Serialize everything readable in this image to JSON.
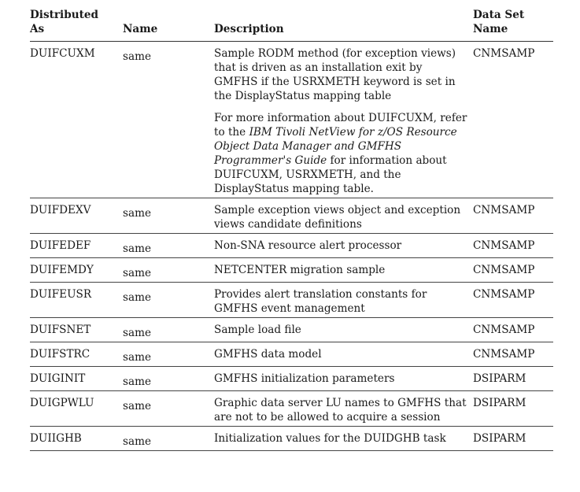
{
  "header": {
    "distributed_as": "Distributed\nAs",
    "name": "Name",
    "description": "Description",
    "data_set_name": "Data Set\nName"
  },
  "rows": [
    {
      "distributed_as": "DUIFCUXM",
      "name": "same",
      "description_p1": "Sample RODM method (for exception views) that is driven as an installation exit by GMFHS if the USRXMETH keyword is set in the DisplayStatus mapping table",
      "description_p2_pre": "For more information about DUIFCUXM, refer to the ",
      "description_p2_em": "IBM Tivoli NetView for z/OS Resource Object Data Manager and GMFHS Programmer's Guide",
      "description_p2_post": " for information about DUIFCUXM, USRXMETH, and the DisplayStatus mapping table.",
      "data_set": "CNMSAMP"
    },
    {
      "distributed_as": "DUIFDEXV",
      "name": "same",
      "description": "Sample exception views object and exception views candidate definitions",
      "data_set": "CNMSAMP"
    },
    {
      "distributed_as": "DUIFEDEF",
      "name": "same",
      "description": "Non-SNA resource alert processor",
      "data_set": "CNMSAMP"
    },
    {
      "distributed_as": "DUIFEMDY",
      "name": "same",
      "description": "NETCENTER migration sample",
      "data_set": "CNMSAMP"
    },
    {
      "distributed_as": "DUIFEUSR",
      "name": "same",
      "description": "Provides alert translation constants for GMFHS event management",
      "data_set": "CNMSAMP"
    },
    {
      "distributed_as": "DUIFSNET",
      "name": "same",
      "description": "Sample load file",
      "data_set": "CNMSAMP"
    },
    {
      "distributed_as": "DUIFSTRC",
      "name": "same",
      "description": "GMFHS data model",
      "data_set": "CNMSAMP"
    },
    {
      "distributed_as": "DUIGINIT",
      "name": "same",
      "description": "GMFHS initialization parameters",
      "data_set": "DSIPARM"
    },
    {
      "distributed_as": "DUIGPWLU",
      "name": "same",
      "description": "Graphic data server LU names to GMFHS that are not to be allowed to acquire a session",
      "data_set": "DSIPARM"
    },
    {
      "distributed_as": "DUIIGHB",
      "name": "same",
      "description": "Initialization values for the DUIDGHB task",
      "data_set": "DSIPARM"
    }
  ]
}
